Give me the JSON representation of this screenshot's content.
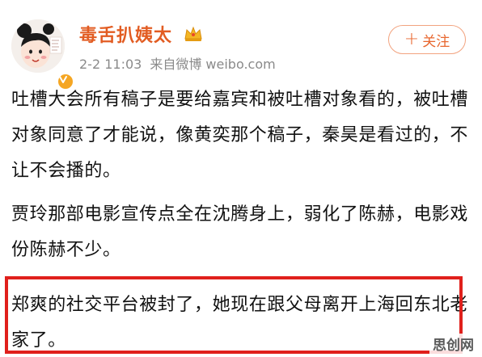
{
  "post": {
    "author": {
      "name": "毒舌扒姨太",
      "avatar_icon": "cartoon-girl-avatar",
      "badge_icon": "verified-v-icon",
      "level_icon": "crown-icon"
    },
    "date": "2-2 11:03",
    "source": "来自微博 weibo.com",
    "follow_label": "关注",
    "follow_plus": "+",
    "paragraphs": [
      "吐槽大会所有稿子是要给嘉宾和被吐槽对象看的，被吐槽对象同意了才能说，像黄奕那个稿子，秦昊是看过的，不让不会播的。",
      "贾玲那部电影宣传点全在沈腾身上，弱化了陈赫，电影戏份陈赫不少。",
      "郑爽的社交平台被封了，她现在跟父母离开上海回东北老家了。"
    ]
  },
  "watermark": "思创网",
  "colors": {
    "username": "#e25c22",
    "follow": "#e8672f",
    "highlight": "#e0201c",
    "meta": "#8a8a8a"
  }
}
